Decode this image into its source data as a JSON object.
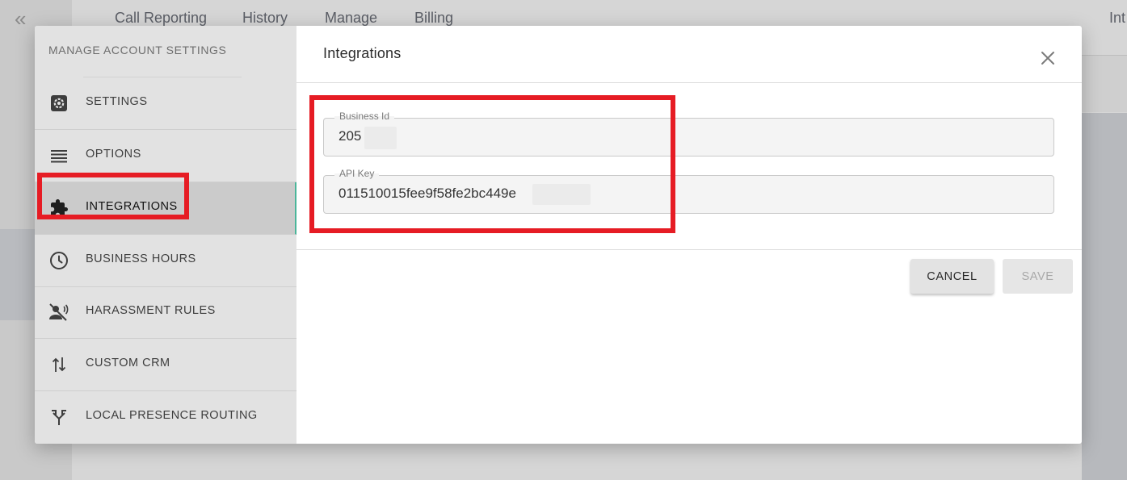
{
  "background": {
    "collapse_glyph": "«",
    "top_tabs": [
      "Call Reporting",
      "History",
      "Manage",
      "Billing",
      "Int"
    ]
  },
  "modal": {
    "sidebar": {
      "title": "MANAGE ACCOUNT SETTINGS",
      "items": [
        {
          "label": "SETTINGS",
          "icon": "gear-icon"
        },
        {
          "label": "OPTIONS",
          "icon": "list-icon"
        },
        {
          "label": "INTEGRATIONS",
          "icon": "puzzle-icon",
          "active": true
        },
        {
          "label": "BUSINESS HOURS",
          "icon": "clock-icon"
        },
        {
          "label": "HARASSMENT RULES",
          "icon": "voice-off-icon"
        },
        {
          "label": "CUSTOM CRM",
          "icon": "swap-vertical-icon"
        },
        {
          "label": "LOCAL PRESENCE ROUTING",
          "icon": "fork-icon"
        }
      ]
    },
    "main": {
      "title": "Integrations",
      "fields": {
        "business_id": {
          "label": "Business Id",
          "value": "205"
        },
        "api_key": {
          "label": "API Key",
          "value": "011510015fee9f58fe2bc449e"
        }
      },
      "buttons": {
        "cancel": "CANCEL",
        "save": "SAVE"
      }
    }
  },
  "colors": {
    "highlight": "#e61c24",
    "active_indicator": "#4bb59a"
  }
}
